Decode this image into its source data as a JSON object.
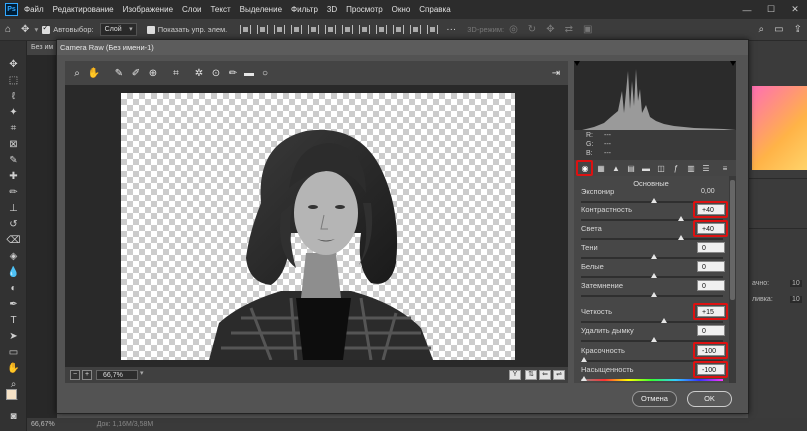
{
  "menubar": {
    "items": [
      "Файл",
      "Редактирование",
      "Изображение",
      "Слои",
      "Текст",
      "Выделение",
      "Фильтр",
      "3D",
      "Просмотр",
      "Окно",
      "Справка"
    ],
    "logo": "Ps"
  },
  "optionsbar": {
    "autoselect_label": "Автовыбор:",
    "autoselect_value": "Слой",
    "show_controls_label": "Показать упр. элем.",
    "mode_3d_label": "3D-режим:"
  },
  "doc": {
    "tab_label": "Без им",
    "zoom_status": "66,67%",
    "status_extra": "Док: 1,16M/3,58M"
  },
  "right_panel": {
    "label_a": "ачно:",
    "label_b": "ливка:",
    "value_a": "10",
    "value_b": "10"
  },
  "camera_raw": {
    "title": "Camera Raw (Без имени-1)",
    "zoom_value": "66,7%",
    "rgb": {
      "r": "R:",
      "g": "G:",
      "b": "B:",
      "r_val": "---",
      "g_val": "---",
      "b_val": "---"
    },
    "panel_title": "Основные",
    "sliders": [
      {
        "label": "Экспонир",
        "value": "0,00",
        "pos": 0.5,
        "plain": true
      },
      {
        "label": "Контрастность",
        "value": "+40",
        "pos": 0.7,
        "highlight": true
      },
      {
        "label": "Света",
        "value": "+40",
        "pos": 0.7,
        "highlight": true
      },
      {
        "label": "Тени",
        "value": "0",
        "pos": 0.5
      },
      {
        "label": "Белые",
        "value": "0",
        "pos": 0.5
      },
      {
        "label": "Затемнение",
        "value": "0",
        "pos": 0.5
      },
      {
        "label": "Четкость",
        "value": "+15",
        "pos": 0.575,
        "highlight": true
      },
      {
        "label": "Удалить дымку",
        "value": "0",
        "pos": 0.5
      },
      {
        "label": "Красочность",
        "value": "-100",
        "pos": 0.0,
        "highlight": true
      },
      {
        "label": "Насыщенность",
        "value": "-100",
        "pos": 0.0,
        "highlight": true,
        "sat": true
      }
    ],
    "cancel_label": "Отмена",
    "ok_label": "OK"
  }
}
